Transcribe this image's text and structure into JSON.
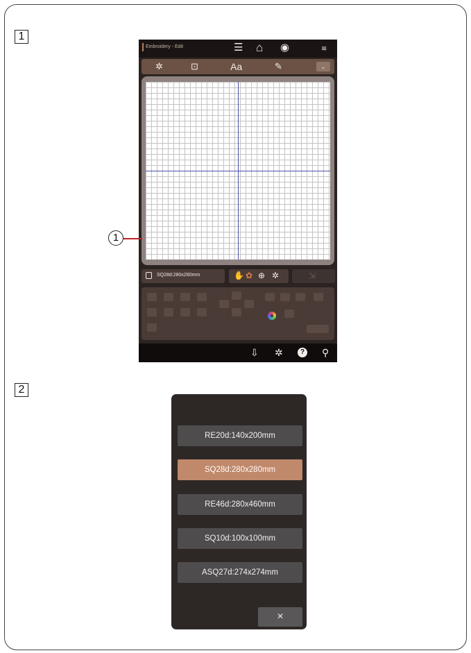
{
  "steps": {
    "step1": "1",
    "step2": "2"
  },
  "callout": {
    "number": "1"
  },
  "screen": {
    "status_title": "Embroidery - Edit",
    "status_icons": {
      "menu": "☰",
      "home": "⌂",
      "logo": "◉",
      "wifi": "≋"
    },
    "toolbar_icons": {
      "pattern": "✲",
      "frame": "⊡",
      "text": "Aa",
      "edit": "✎",
      "dropdown": "⌄"
    },
    "hoop_label": "SQ28d:280x280mm",
    "zoom_icons": {
      "hand": "✋",
      "flower": "✿",
      "zoom_in": "⊕",
      "zoom_out": "✲"
    },
    "right_icons": {
      "move": "⇲"
    },
    "bottom_icons": {
      "upload": "⇩",
      "settings": "✲",
      "help": "?",
      "key": "⚲"
    }
  },
  "dialog": {
    "options": [
      {
        "label": "RE20d:140x200mm",
        "selected": false
      },
      {
        "label": "SQ28d:280x280mm",
        "selected": true
      },
      {
        "label": "RE46d:280x460mm",
        "selected": false
      },
      {
        "label": "SQ10d:100x100mm",
        "selected": false
      },
      {
        "label": "ASQ27d:274x274mm",
        "selected": false
      }
    ],
    "close_label": "×"
  },
  "colors": {
    "accent_selected": "#c0896b",
    "screen_bg": "#2b2321",
    "axis_line": "#4a4fa8",
    "callout_line": "#c0202a"
  }
}
